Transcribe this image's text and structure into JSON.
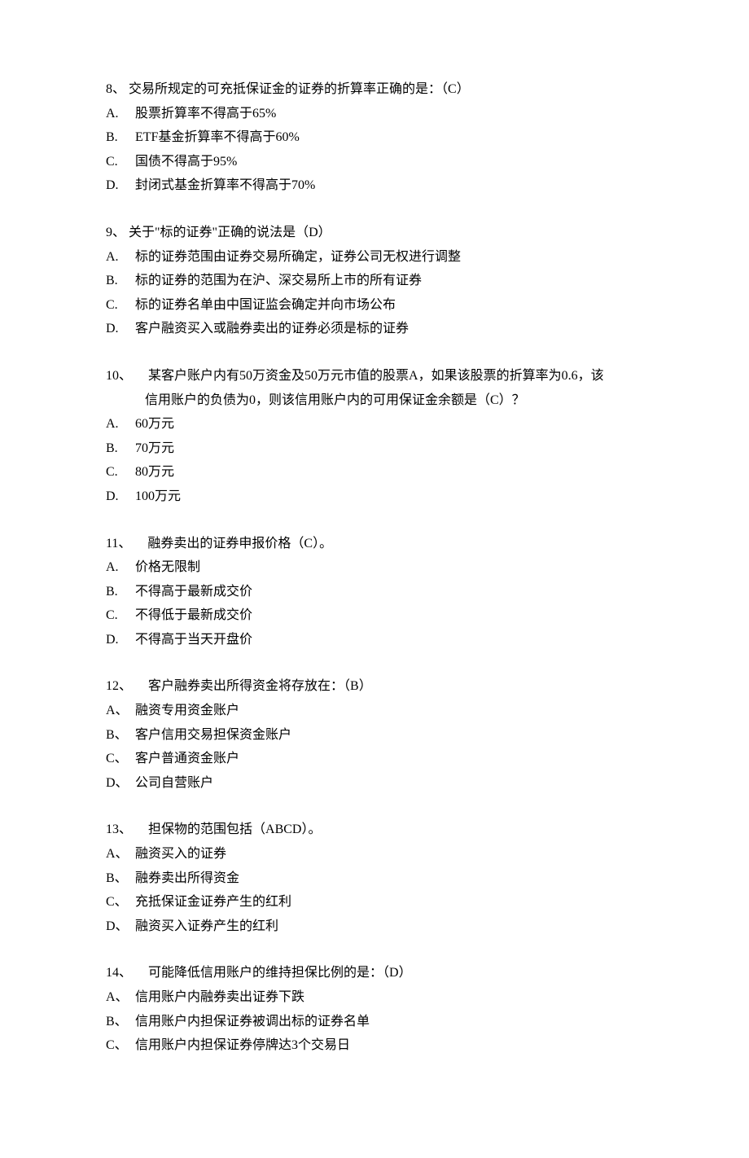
{
  "questions": [
    {
      "num": "8、",
      "text": "交易所规定的可充抵保证金的证券的折算率正确的是：（C）",
      "options": [
        {
          "letter": "A.",
          "text": "股票折算率不得高于65%"
        },
        {
          "letter": "B.",
          "text": "ETF基金折算率不得高于60%"
        },
        {
          "letter": "C.",
          "text": "国债不得高于95%"
        },
        {
          "letter": "D.",
          "text": "封闭式基金折算率不得高于70%"
        }
      ]
    },
    {
      "num": "9、",
      "text": "关于\"标的证券\"正确的说法是（D）",
      "options": [
        {
          "letter": "A.",
          "text": "标的证券范围由证券交易所确定，证券公司无权进行调整"
        },
        {
          "letter": "B.",
          "text": "标的证券的范围为在沪、深交易所上市的所有证券"
        },
        {
          "letter": "C.",
          "text": "标的证券名单由中国证监会确定并向市场公布"
        },
        {
          "letter": "D.",
          "text": "客户融资买入或融券卖出的证券必须是标的证券"
        }
      ]
    },
    {
      "num": "10、",
      "text": "某客户账户内有50万资金及50万元市值的股票A，如果该股票的折算率为0.6，该",
      "continuation": "信用账户的负债为0，则该信用账户内的可用保证金余额是（C）？",
      "options": [
        {
          "letter": "A.",
          "text": "60万元"
        },
        {
          "letter": "B.",
          "text": "70万元"
        },
        {
          "letter": "C.",
          "text": "80万元"
        },
        {
          "letter": "D.",
          "text": "100万元"
        }
      ]
    },
    {
      "num": "11、",
      "text": "融券卖出的证券申报价格（C）。",
      "options": [
        {
          "letter": "A.",
          "text": "价格无限制"
        },
        {
          "letter": "B.",
          "text": "不得高于最新成交价"
        },
        {
          "letter": "C.",
          "text": "不得低于最新成交价"
        },
        {
          "letter": "D.",
          "text": "不得高于当天开盘价"
        }
      ]
    },
    {
      "num": "12、",
      "text": "客户融券卖出所得资金将存放在：（B）",
      "options": [
        {
          "letter": "A、",
          "text": "融资专用资金账户"
        },
        {
          "letter": "B、",
          "text": "客户信用交易担保资金账户"
        },
        {
          "letter": "C、",
          "text": "客户普通资金账户"
        },
        {
          "letter": "D、",
          "text": "公司自营账户"
        }
      ]
    },
    {
      "num": "13、",
      "text": "担保物的范围包括（ABCD）。",
      "options": [
        {
          "letter": "A、",
          "text": "融资买入的证券"
        },
        {
          "letter": "B、",
          "text": "融券卖出所得资金"
        },
        {
          "letter": "C、",
          "text": "充抵保证金证券产生的红利"
        },
        {
          "letter": "D、",
          "text": "融资买入证券产生的红利"
        }
      ]
    },
    {
      "num": "14、",
      "text": "可能降低信用账户的维持担保比例的是：（D）",
      "options": [
        {
          "letter": "A、",
          "text": "信用账户内融券卖出证券下跌"
        },
        {
          "letter": "B、",
          "text": "信用账户内担保证券被调出标的证券名单"
        },
        {
          "letter": "C、",
          "text": "信用账户内担保证券停牌达3个交易日"
        }
      ]
    }
  ]
}
